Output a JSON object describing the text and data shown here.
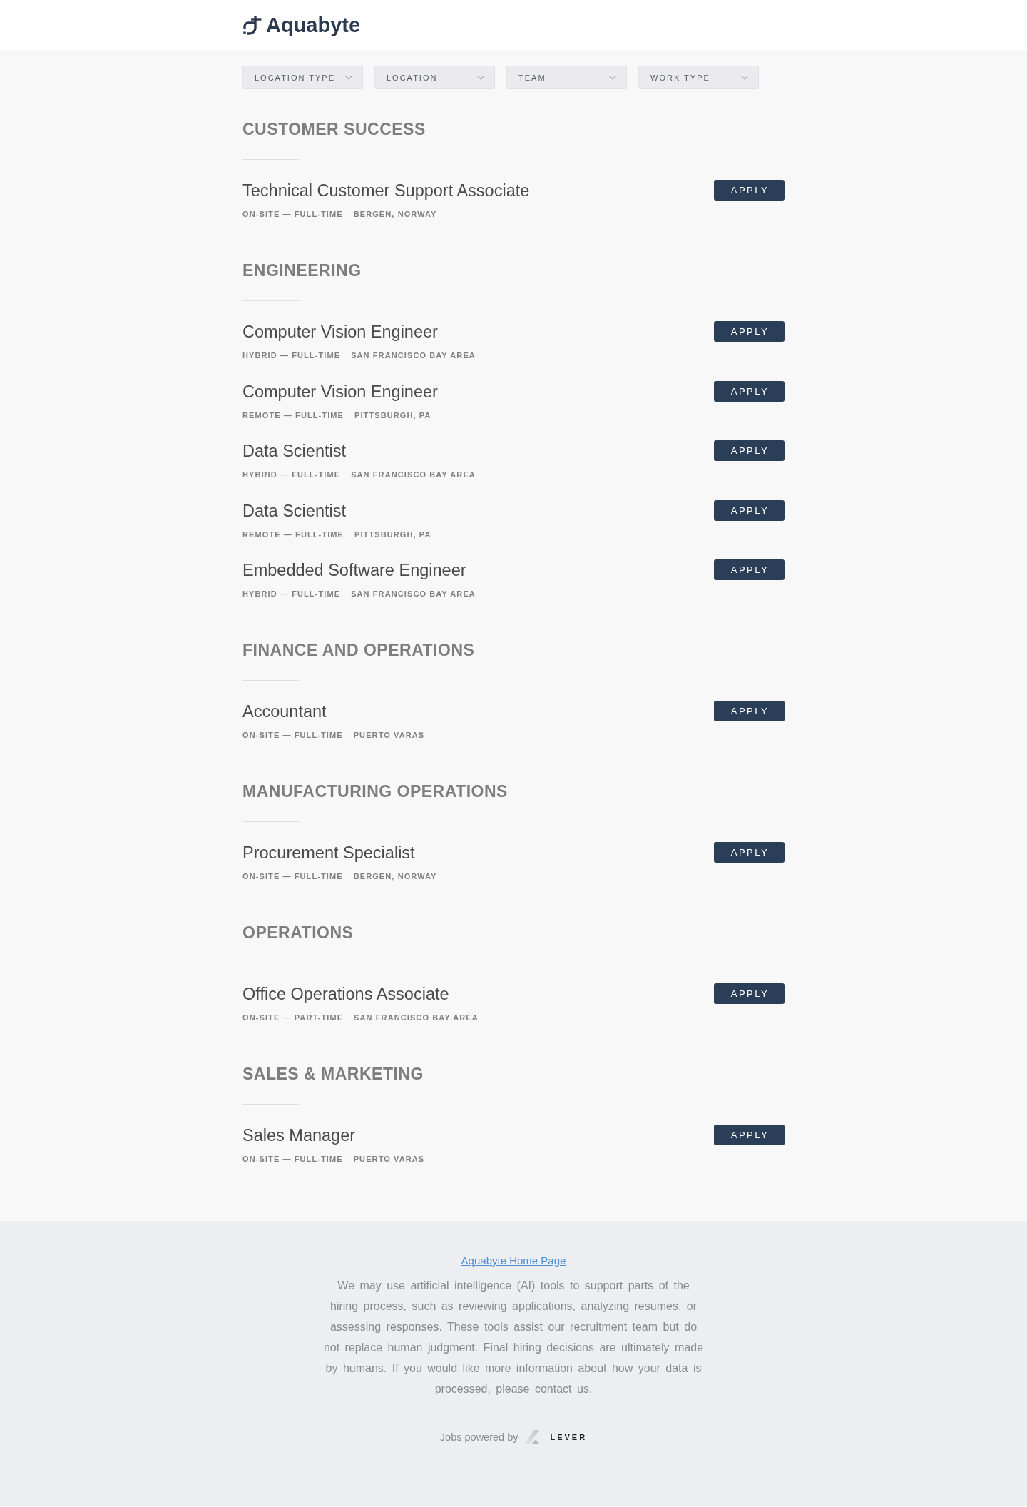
{
  "header": {
    "logo_text": "Aquabyte"
  },
  "filters": [
    {
      "label": "LOCATION TYPE"
    },
    {
      "label": "LOCATION"
    },
    {
      "label": "TEAM"
    },
    {
      "label": "WORK TYPE"
    }
  ],
  "sections": [
    {
      "title": "CUSTOMER SUCCESS",
      "jobs": [
        {
          "title": "Technical Customer Support Associate",
          "commitment": "ON-SITE — FULL-TIME",
          "location": "BERGEN, NORWAY",
          "action": "APPLY"
        }
      ]
    },
    {
      "title": "ENGINEERING",
      "jobs": [
        {
          "title": "Computer Vision Engineer",
          "commitment": "HYBRID — FULL-TIME",
          "location": "SAN FRANCISCO BAY AREA",
          "action": "APPLY"
        },
        {
          "title": "Computer Vision Engineer",
          "commitment": "REMOTE — FULL-TIME",
          "location": "PITTSBURGH, PA",
          "action": "APPLY"
        },
        {
          "title": "Data Scientist",
          "commitment": "HYBRID — FULL-TIME",
          "location": "SAN FRANCISCO BAY AREA",
          "action": "APPLY"
        },
        {
          "title": "Data Scientist",
          "commitment": "REMOTE — FULL-TIME",
          "location": "PITTSBURGH, PA",
          "action": "APPLY"
        },
        {
          "title": "Embedded Software Engineer",
          "commitment": "HYBRID — FULL-TIME",
          "location": "SAN FRANCISCO BAY AREA",
          "action": "APPLY"
        }
      ]
    },
    {
      "title": "FINANCE AND OPERATIONS",
      "jobs": [
        {
          "title": "Accountant",
          "commitment": "ON-SITE — FULL-TIME",
          "location": "PUERTO VARAS",
          "action": "APPLY"
        }
      ]
    },
    {
      "title": "MANUFACTURING OPERATIONS",
      "jobs": [
        {
          "title": "Procurement Specialist",
          "commitment": "ON-SITE — FULL-TIME",
          "location": "BERGEN, NORWAY",
          "action": "APPLY"
        }
      ]
    },
    {
      "title": "OPERATIONS",
      "jobs": [
        {
          "title": "Office Operations Associate",
          "commitment": "ON-SITE — PART-TIME",
          "location": "SAN FRANCISCO BAY AREA",
          "action": "APPLY"
        }
      ]
    },
    {
      "title": "SALES & MARKETING",
      "jobs": [
        {
          "title": "Sales Manager",
          "commitment": "ON-SITE — FULL-TIME",
          "location": "PUERTO VARAS",
          "action": "APPLY"
        }
      ]
    }
  ],
  "footer": {
    "link": "Aquabyte Home Page",
    "notice": "We may use artificial intelligence (AI) tools to support parts of the hiring process, such as reviewing applications, analyzing resumes, or assessing responses. These tools assist our recruitment team but do not replace human judgment. Final hiring decisions are ultimately made by humans. If you would like more information about how your data is processed, please contact us.",
    "powered_by": "Jobs powered by",
    "brand": "LEVER"
  }
}
